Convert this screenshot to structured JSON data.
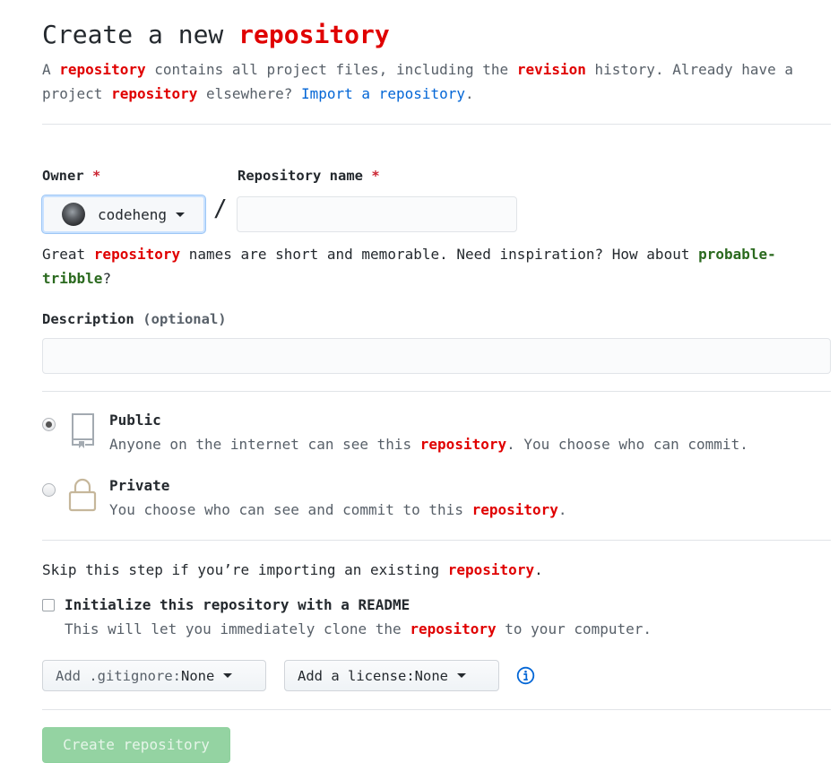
{
  "header": {
    "title_prefix": "Create a new ",
    "title_highlight": "repository",
    "lead_1": "A ",
    "lead_hl_1": "repository",
    "lead_2": " contains all project files, including the ",
    "lead_hl_2": "revision",
    "lead_3": " history. Already have a project ",
    "lead_hl_3": "repository",
    "lead_4": " elsewhere? ",
    "import_link": "Import a repository",
    "lead_5": "."
  },
  "owner": {
    "label": "Owner",
    "required_mark": "*",
    "selected": "codeheng",
    "avatar_icon": "user-avatar"
  },
  "repo_name": {
    "label": "Repository name",
    "required_mark": "*",
    "value": "",
    "placeholder": ""
  },
  "separator": "/",
  "name_hint": {
    "part_1": "Great ",
    "hl": "repository",
    "part_2": " names are short and memorable. Need inspiration? How about ",
    "suggestion": "probable-tribble",
    "part_3": "?"
  },
  "description": {
    "label": "Description",
    "optional": "(optional)",
    "value": "",
    "placeholder": ""
  },
  "visibility": {
    "selected": "public",
    "public": {
      "title": "Public",
      "desc_1": "Anyone on the internet can see this ",
      "desc_hl": "repository",
      "desc_2": ". You choose who can commit.",
      "icon": "repo-book-icon"
    },
    "private": {
      "title": "Private",
      "desc_1": "You choose who can see and commit to this ",
      "desc_hl": "repository",
      "desc_2": ".",
      "icon": "lock-icon"
    }
  },
  "init": {
    "skip_1": "Skip this step if you’re importing an existing ",
    "skip_hl": "repository",
    "skip_2": ".",
    "readme_label": "Initialize this repository with a README",
    "readme_checked": false,
    "readme_desc_1": "This will let you immediately clone the ",
    "readme_desc_hl": "repository",
    "readme_desc_2": " to your computer."
  },
  "gitignore": {
    "key": "Add .gitignore: ",
    "value": "None"
  },
  "license": {
    "key": "Add a license: ",
    "value": "None"
  },
  "submit_label": "Create repository",
  "colors": {
    "highlight": "#e00000",
    "link": "#0366d6",
    "suggestion": "#2b6a1f",
    "submit_bg": "#94d3a2"
  }
}
